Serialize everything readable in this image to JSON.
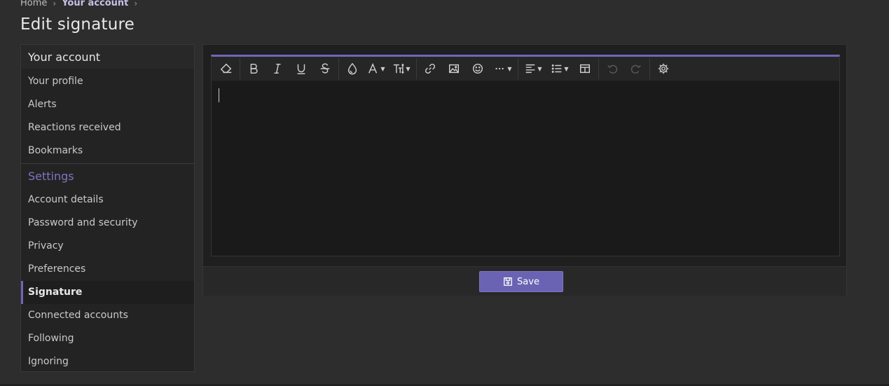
{
  "breadcrumb": {
    "items": [
      "Home",
      "Your account"
    ]
  },
  "page_title": "Edit signature",
  "sidebar": {
    "header": "Your account",
    "items_top": [
      {
        "label": "Your profile"
      },
      {
        "label": "Alerts"
      },
      {
        "label": "Reactions received"
      },
      {
        "label": "Bookmarks"
      }
    ],
    "section_title": "Settings",
    "items_settings": [
      {
        "label": "Account details"
      },
      {
        "label": "Password and security"
      },
      {
        "label": "Privacy"
      },
      {
        "label": "Preferences"
      },
      {
        "label": "Signature",
        "active": true
      },
      {
        "label": "Connected accounts"
      },
      {
        "label": "Following"
      },
      {
        "label": "Ignoring"
      }
    ]
  },
  "editor": {
    "toolbar": [
      "eraser-icon",
      "bold-icon",
      "italic-icon",
      "underline-icon",
      "strikethrough-icon",
      "text-color-icon",
      "font-family-icon",
      "font-size-icon",
      "link-icon",
      "image-icon",
      "smilie-icon",
      "more-options-icon",
      "align-icon",
      "list-icon",
      "table-icon",
      "undo-icon",
      "redo-icon",
      "settings-icon"
    ],
    "content": ""
  },
  "save_button": {
    "label": "Save"
  },
  "colors": {
    "accent": "#6f67b8",
    "background": "#2d2d2d",
    "panel": "#1f1f1f"
  }
}
